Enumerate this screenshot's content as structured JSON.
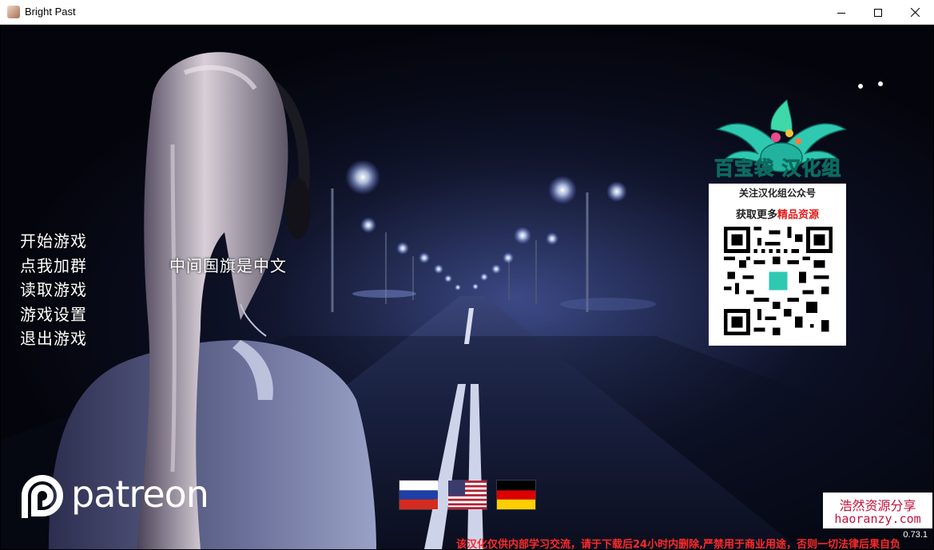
{
  "window": {
    "title": "Bright Past",
    "controls": [
      "minimize-icon",
      "maximize-icon",
      "close-icon"
    ]
  },
  "menu": {
    "items": [
      "开始游戏",
      "点我加群",
      "读取游戏",
      "游戏设置",
      "退出游戏"
    ]
  },
  "center_note": "中间国旗是中文",
  "translation_group": {
    "name": "百宝袋 汉化组",
    "follow_line": "关注汉化组公众号",
    "resource_prefix": "获取更多",
    "resource_highlight": "精品资源",
    "accent_color": "#2fd0b8"
  },
  "patreon": {
    "label": "patreon",
    "icon": "patreon-icon"
  },
  "languages": [
    {
      "name": "russian-flag"
    },
    {
      "name": "us-flag"
    },
    {
      "name": "german-flag"
    }
  ],
  "watermark": {
    "line1": "浩然资源分享",
    "line2": "haoranzy.com"
  },
  "version": "0.73.1",
  "disclaimer": "该汉化仅供内部学习交流，请于下载后24小时内删除,严禁用于商业用途，否则一切法律后果自负"
}
